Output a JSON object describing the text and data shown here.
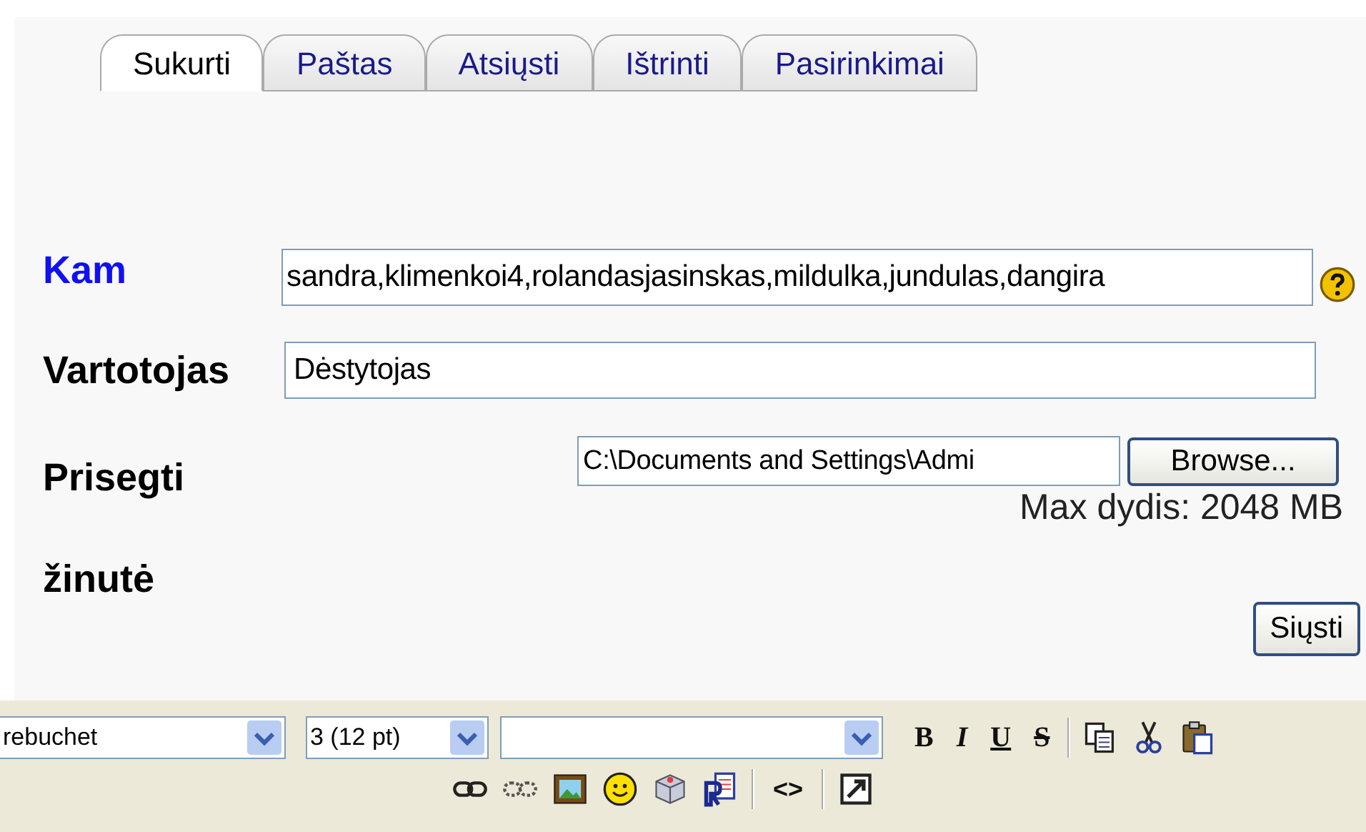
{
  "tabs": [
    {
      "label": "Sukurti",
      "selected": true
    },
    {
      "label": "Paštas",
      "selected": false
    },
    {
      "label": "Atsiųsti",
      "selected": false
    },
    {
      "label": "Ištrinti",
      "selected": false
    },
    {
      "label": "Pasirinkimai",
      "selected": false
    }
  ],
  "form": {
    "to": {
      "label": "Kam",
      "value": "sandra,klimenkoi4,rolandasjasinskas,mildulka,jundulas,dangira"
    },
    "user": {
      "label": "Vartotojas",
      "value": "Dėstytojas"
    },
    "attach": {
      "label": "Prisegti",
      "value": "C:\\Documents and Settings\\Admi",
      "button": "Browse...",
      "note": "Max dydis: 2048 MB"
    },
    "message": {
      "label": "žinutė"
    },
    "send_button": "Siųsti"
  },
  "editor_toolbar": {
    "font": "rebuchet",
    "size": "3 (12 pt)",
    "format_buttons": [
      {
        "label": "B",
        "kind": "bold"
      },
      {
        "label": "I",
        "kind": "italic"
      },
      {
        "label": "U",
        "kind": "underline"
      },
      {
        "label": "S",
        "kind": "strike"
      }
    ],
    "source_button": "<>"
  }
}
